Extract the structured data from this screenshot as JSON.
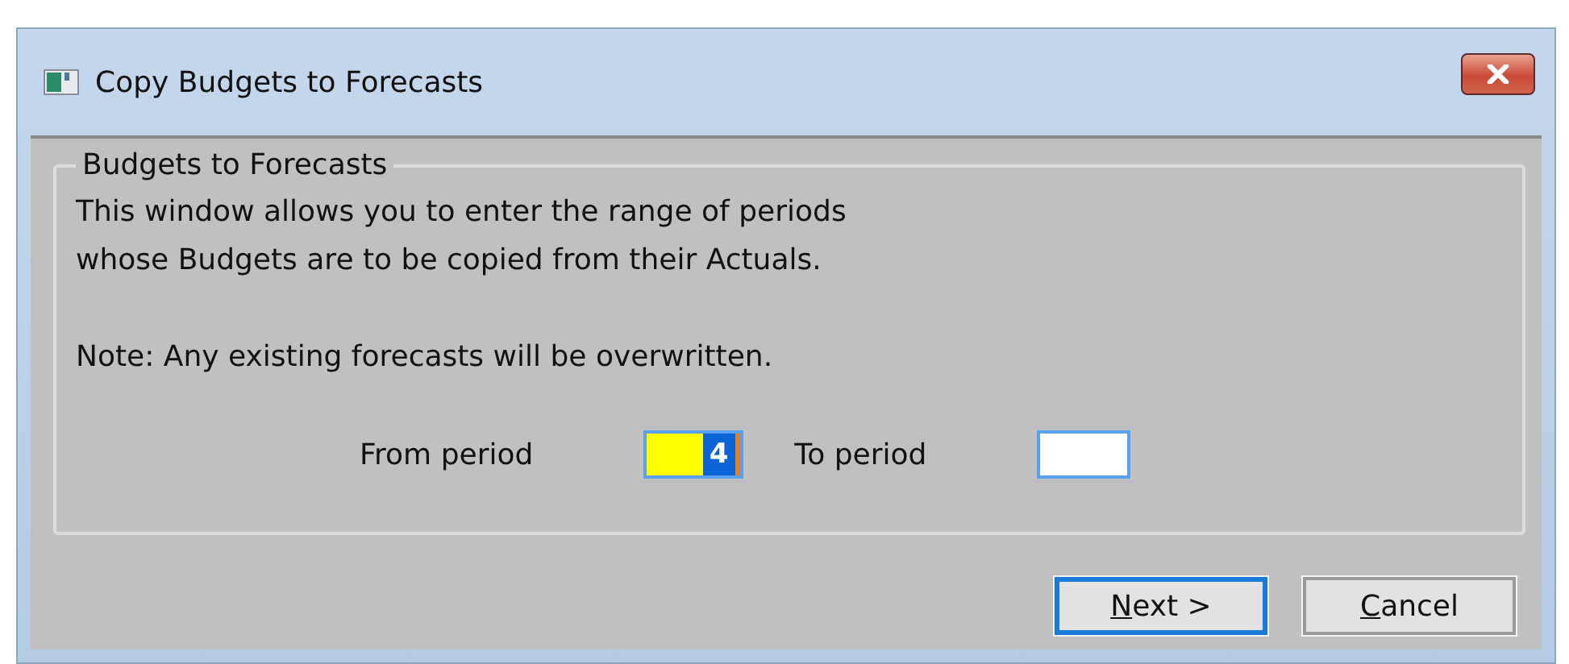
{
  "window": {
    "title": "Copy Budgets to Forecasts"
  },
  "group": {
    "title": "Budgets to Forecasts",
    "paragraphs": [
      "This window allows you to enter the range of periods\nwhose Budgets are to be copied from their Actuals.",
      "Note: Any existing forecasts will be overwritten."
    ],
    "fields": [
      {
        "label": "From period",
        "value": "4",
        "focused": true
      },
      {
        "label": "To period",
        "focused": false
      }
    ]
  },
  "buttons": [
    {
      "label": "Next >",
      "default": true
    },
    {
      "label": "Cancel",
      "default": false
    }
  ]
}
